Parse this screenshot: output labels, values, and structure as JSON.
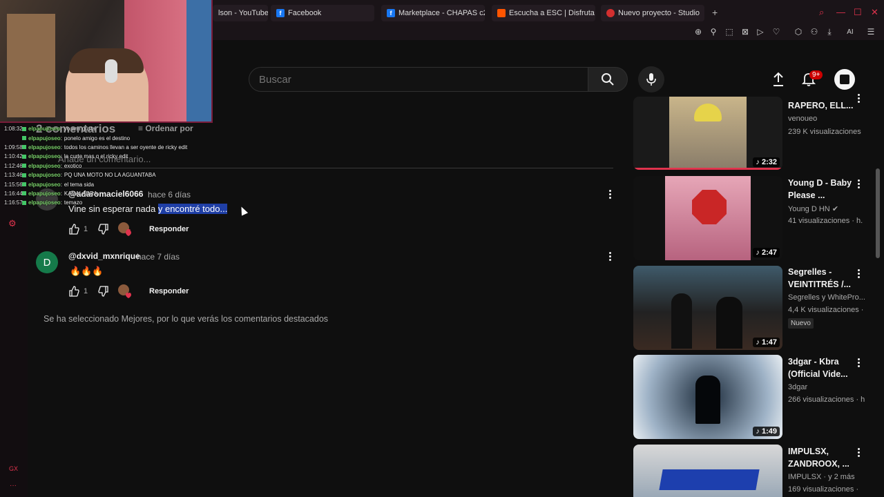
{
  "browser": {
    "tabs": [
      {
        "label": "lson - YouTube",
        "icon": "youtube-icon"
      },
      {
        "label": "Facebook",
        "icon": "facebook-icon"
      },
      {
        "label": "Marketplace - CHAPAS c2",
        "icon": "facebook-icon"
      },
      {
        "label": "Escucha a ESC | Disfruta",
        "icon": "soundcloud-icon"
      },
      {
        "label": "Nuevo proyecto - Studio",
        "icon": "studio-icon"
      }
    ],
    "ai_label": "AI",
    "gx_label": "GX"
  },
  "header": {
    "search_placeholder": "Buscar",
    "notification_count": "9+"
  },
  "chat": [
    {
      "time": "1:08:32",
      "user": "elpapujoseo",
      "msg": "yo ami gusta"
    },
    {
      "time": "",
      "user": "elpapujoseo",
      "msg": "ponelo amigo es el destino"
    },
    {
      "time": "1:09:58",
      "user": "elpapujoseo",
      "msg": "todos los caminos llevan a ser oyente de ricky edit"
    },
    {
      "time": "1:10:42",
      "user": "elpapujoseo",
      "msg": "la curte mas q el ricky edit"
    },
    {
      "time": "1:12:46",
      "user": "elpapujoseo",
      "msg": "exotico"
    },
    {
      "time": "1:13:46",
      "user": "elpapujoseo",
      "msg": "PQ UNA MOTO NO LA AGUANTABA"
    },
    {
      "time": "1:15:56",
      "user": "elpapujoseo",
      "msg": "el tema sida"
    },
    {
      "time": "1:16:44",
      "user": "elpapujoseo",
      "msg": "KADALABRA"
    },
    {
      "time": "1:16:57",
      "user": "elpapujoseo",
      "msg": "temazo"
    }
  ],
  "comments_section": {
    "header": "2 comentarios",
    "sort_label": "Ordenar por",
    "add_placeholder": "Añade un comentario...",
    "notice": "Se ha seleccionado Mejores, por lo que verás los comentarios destacados",
    "comments": [
      {
        "author": "@adaromaciel6066",
        "time": "hace 6 días",
        "text_plain": "Vine sin esperar nada ",
        "text_highlight": "y encontré todo...",
        "likes": "1",
        "reply": "Responder",
        "avatar_letter": ""
      },
      {
        "author": "@dxvid_mxnrique",
        "time": "hace 7 días",
        "text_plain": "🔥🔥🔥",
        "text_highlight": "",
        "likes": "1",
        "reply": "Responder",
        "avatar_letter": "D"
      }
    ]
  },
  "sidebar": {
    "videos": [
      {
        "title": "RAPERO, ELL...",
        "channel": "venoueo",
        "views": "239 K visualizaciones",
        "duration": "2:32",
        "badge": ""
      },
      {
        "title": "Young D - Baby Please ...",
        "channel": "Young D HN",
        "views": "41 visualizaciones · h.",
        "duration": "2:47",
        "badge": ""
      },
      {
        "title": "Segrelles - VEINTITRÉS /...",
        "channel": "Segrelles y WhitePro...",
        "views": "4,4 K visualizaciones ·",
        "duration": "1:47",
        "badge": "Nuevo"
      },
      {
        "title": "3dgar - Kbra (Official Vide...",
        "channel": "3dgar",
        "views": "266 visualizaciones · h",
        "duration": "1:49",
        "badge": ""
      },
      {
        "title": "IMPULSX, ZANDROOX, ...",
        "channel": "IMPULSX · y 2 más",
        "views": "169 visualizaciones ·",
        "duration": "",
        "badge": ""
      }
    ]
  },
  "colors": {
    "accent": "#e0334d",
    "highlight": "#1f3fa6",
    "background": "#0f0f0f"
  }
}
